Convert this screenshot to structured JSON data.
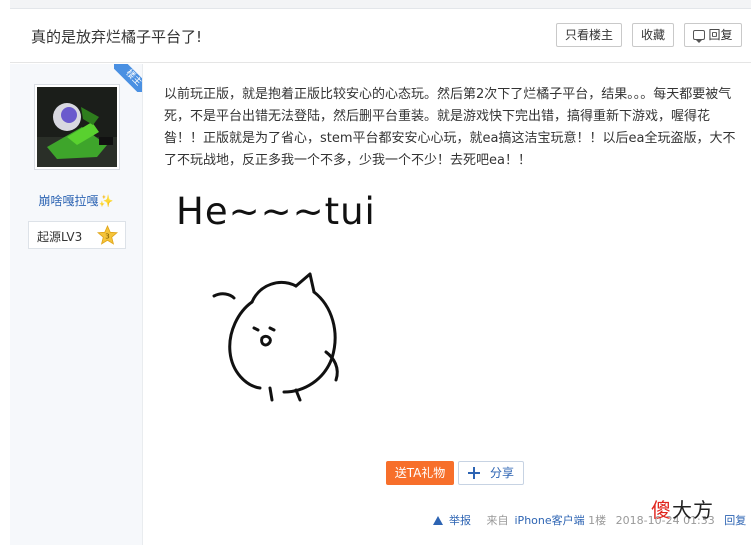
{
  "header": {
    "title": "真的是放弃烂橘子平台了!",
    "only_op_label": "只看楼主",
    "favorite_label": "收藏",
    "reply_label": "回复"
  },
  "author": {
    "badge": "楼主",
    "username": "崩啥嘎拉嘎✨",
    "level_name": "起源LV3",
    "level_number": "3"
  },
  "post": {
    "body": "以前玩正版，就是抱着正版比较安心的心态玩。然后第2次下了烂橘子平台，结果。。。每天都要被气死，不是平台出错无法登陆，然后删平台重装。就是游戏快下完出错，搞得重新下游戏，喔得花昝！！正版就是为了省心，stem平台都安安心心玩，就ea搞这洁宝玩意！！以后ea全玩盗版，大不了不玩战地，反正多我一个不多，少我一个不少！去死吧ea！！",
    "sticker_text": "He~~~tui",
    "gift_label": "送TA礼物",
    "share_label": "分享"
  },
  "footer": {
    "report_label": "举报",
    "from_prefix": "来自",
    "from_client": "iPhone客户端",
    "floor": "1楼",
    "timestamp": "2018-10-24 01:33",
    "reply_label": "回复"
  },
  "watermark": {
    "first_char": "傻",
    "rest": "大方"
  },
  "colors": {
    "accent": "#2d64b3",
    "gift": "#f76f2b",
    "badge": "#4a90e2"
  }
}
